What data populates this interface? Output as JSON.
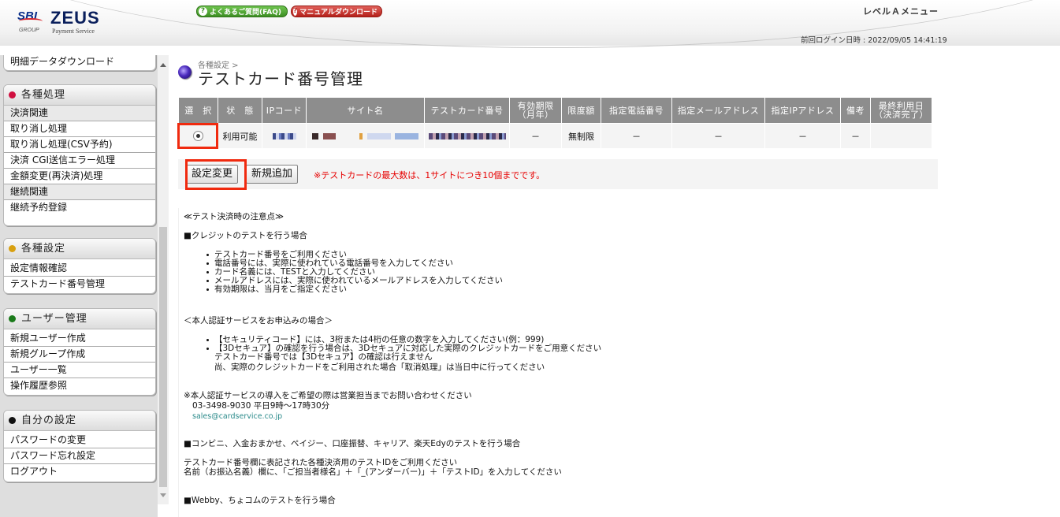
{
  "header": {
    "logo_sbi": "SBI",
    "logo_zeus": "ZEUS",
    "logo_group": "GROUP",
    "logo_payment": "Payment Service",
    "faq_button": "よくあるご質問(FAQ)",
    "manual_button": "マニュアルダウンロード",
    "level_menu": "レベルＡメニュー",
    "last_login": "前回ログイン日時 : 2022/09/05 14:41:19"
  },
  "sidebar": {
    "top_item": "明細データダウンロード",
    "sections": [
      {
        "title": "各種処理",
        "dot_color": "#d01040",
        "groups": [
          {
            "sub": "決済関連",
            "items": [
              "取り消し処理",
              "取り消し処理(CSV予約)",
              "決済 CGI送信エラー処理",
              "金額変更(再決済)処理"
            ]
          },
          {
            "sub": "継続関連",
            "items": [
              "継続予約登録"
            ]
          }
        ]
      },
      {
        "title": "各種設定",
        "dot_color": "#d8a010",
        "items": [
          "設定情報確認",
          "テストカード番号管理"
        ]
      },
      {
        "title": "ユーザー管理",
        "dot_color": "#1a7a1a",
        "items": [
          "新規ユーザー作成",
          "新規グループ作成",
          "ユーザー一覧",
          "操作履歴参照"
        ]
      },
      {
        "title": "自分の設定",
        "dot_color": "#111111",
        "items": [
          "パスワードの変更",
          "パスワード忘れ設定",
          "ログアウト"
        ]
      }
    ]
  },
  "main": {
    "breadcrumb": "各種設定 >",
    "title": "テストカード番号管理",
    "table": {
      "headers": [
        "選　択",
        "状　態",
        "IPコード",
        "サイト名",
        "テストカード番号",
        "有効期限\n（月年）",
        "限度額",
        "指定電話番号",
        "指定メールアドレス",
        "指定IPアドレス",
        "備考",
        "最終利用日\n（決済完了）"
      ],
      "row": {
        "status": "利用可能",
        "expiry": "－",
        "limit": "無制限",
        "phone": "－",
        "email": "－",
        "ip": "－",
        "remarks": "－",
        "last_used": ""
      }
    },
    "buttons": {
      "change": "設定変更",
      "add": "新規追加"
    },
    "notice": "※テストカードの最大数は、1サイトにつき10個までです。",
    "notes": {
      "heading": "≪テスト決済時の注意点≫",
      "credit_title": "■クレジットのテストを行う場合",
      "credit_items": [
        "テストカード番号をご利用ください",
        "電話番号には、実際に使われている電話番号を入力してください",
        "カード名義には、TESTと入力してください",
        "メールアドレスには、実際に使われているメールアドレスを入力してください",
        "有効期限は、当月をご指定ください"
      ],
      "auth_title": "＜本人認証サービスをお申込みの場合＞",
      "auth_items": [
        "【セキュリティコード】には、3桁または4桁の任意の数字を入力してください(例：999)",
        "【3Dセキュア】の確認を行う場合は、3Dセキュアに対応した実際のクレジットカードをご用意ください"
      ],
      "auth_sub1": "テストカード番号では【3Dセキュア】の確認は行えません",
      "auth_sub2": "尚、実際のクレジットカードをご利用された場合「取消処理」は当日中に行ってください",
      "contact_line": "※本人認証サービスの導入をご希望の際は営業担当までお問い合わせください",
      "contact_tel": "03-3498-9030 平日9時～17時30分",
      "contact_mail": "sales@cardservice.co.jp",
      "conv_title": "■コンビニ、入金おまかせ、ペイジー、口座振替、キャリア、楽天Edyのテストを行う場合",
      "conv_line1": "テストカード番号欄に表記された各種決済用のテストIDをご利用ください",
      "conv_line2": "名前（お振込名義）欄に、「ご担当者様名」＋「_(アンダーバー)」＋「テストID」を入力してください",
      "webby_title": "■Webby、ちょコムのテストを行う場合"
    }
  }
}
